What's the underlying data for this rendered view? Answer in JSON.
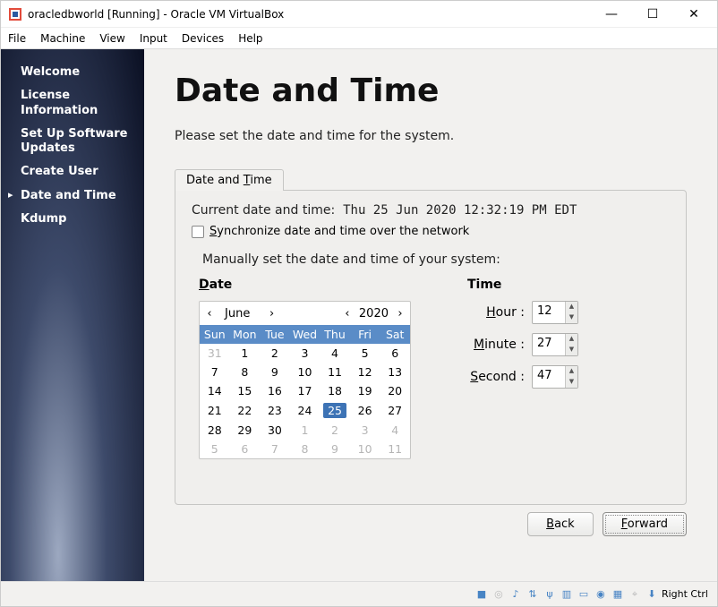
{
  "window": {
    "title": "oracledbworld [Running] - Oracle VM VirtualBox"
  },
  "menubar": {
    "items": [
      "File",
      "Machine",
      "View",
      "Input",
      "Devices",
      "Help"
    ]
  },
  "sidebar": {
    "items": [
      {
        "label": "Welcome"
      },
      {
        "label": "License Information"
      },
      {
        "label": "Set Up Software Updates"
      },
      {
        "label": "Create User"
      },
      {
        "label": "Date and Time"
      },
      {
        "label": "Kdump"
      }
    ]
  },
  "page": {
    "title": "Date and Time",
    "intro": "Please set the date and time for the system."
  },
  "tab": {
    "prefix": "Date and ",
    "ulchar": "T",
    "suffix": "ime"
  },
  "datetime": {
    "current_label": "Current date and time:",
    "current_value": "Thu 25 Jun 2020 12:32:19 PM EDT",
    "sync_prefix": "S",
    "sync_rest": "ynchronize date and time over the network",
    "manual_label": "Manually set the date and time of your system:",
    "date_ul": "D",
    "date_rest": "ate",
    "time_label": "Time",
    "month": "June",
    "year": "2020",
    "weekdays": [
      "Sun",
      "Mon",
      "Tue",
      "Wed",
      "Thu",
      "Fri",
      "Sat"
    ],
    "weeks": [
      [
        {
          "d": "31",
          "dim": true
        },
        {
          "d": "1"
        },
        {
          "d": "2"
        },
        {
          "d": "3"
        },
        {
          "d": "4"
        },
        {
          "d": "5"
        },
        {
          "d": "6"
        }
      ],
      [
        {
          "d": "7"
        },
        {
          "d": "8"
        },
        {
          "d": "9"
        },
        {
          "d": "10"
        },
        {
          "d": "11"
        },
        {
          "d": "12"
        },
        {
          "d": "13"
        }
      ],
      [
        {
          "d": "14"
        },
        {
          "d": "15"
        },
        {
          "d": "16"
        },
        {
          "d": "17"
        },
        {
          "d": "18"
        },
        {
          "d": "19"
        },
        {
          "d": "20"
        }
      ],
      [
        {
          "d": "21"
        },
        {
          "d": "22"
        },
        {
          "d": "23"
        },
        {
          "d": "24"
        },
        {
          "d": "25",
          "sel": true
        },
        {
          "d": "26"
        },
        {
          "d": "27"
        }
      ],
      [
        {
          "d": "28"
        },
        {
          "d": "29"
        },
        {
          "d": "30"
        },
        {
          "d": "1",
          "dim": true
        },
        {
          "d": "2",
          "dim": true
        },
        {
          "d": "3",
          "dim": true
        },
        {
          "d": "4",
          "dim": true
        }
      ],
      [
        {
          "d": "5",
          "dim": true
        },
        {
          "d": "6",
          "dim": true
        },
        {
          "d": "7",
          "dim": true
        },
        {
          "d": "8",
          "dim": true
        },
        {
          "d": "9",
          "dim": true
        },
        {
          "d": "10",
          "dim": true
        },
        {
          "d": "11",
          "dim": true
        }
      ]
    ],
    "hour_ul": "H",
    "hour_rest": "our :",
    "hour_val": "12",
    "minute_ul": "M",
    "minute_rest": "inute :",
    "minute_val": "27",
    "second_ul": "S",
    "second_rest": "econd :",
    "second_val": "47"
  },
  "footer": {
    "back_ul": "B",
    "back_rest": "ack",
    "forward_ul": "F",
    "forward_rest": "orward"
  },
  "statusbar": {
    "host_key": "Right Ctrl"
  },
  "nav_glyphs": {
    "left": "‹",
    "right": "›"
  }
}
